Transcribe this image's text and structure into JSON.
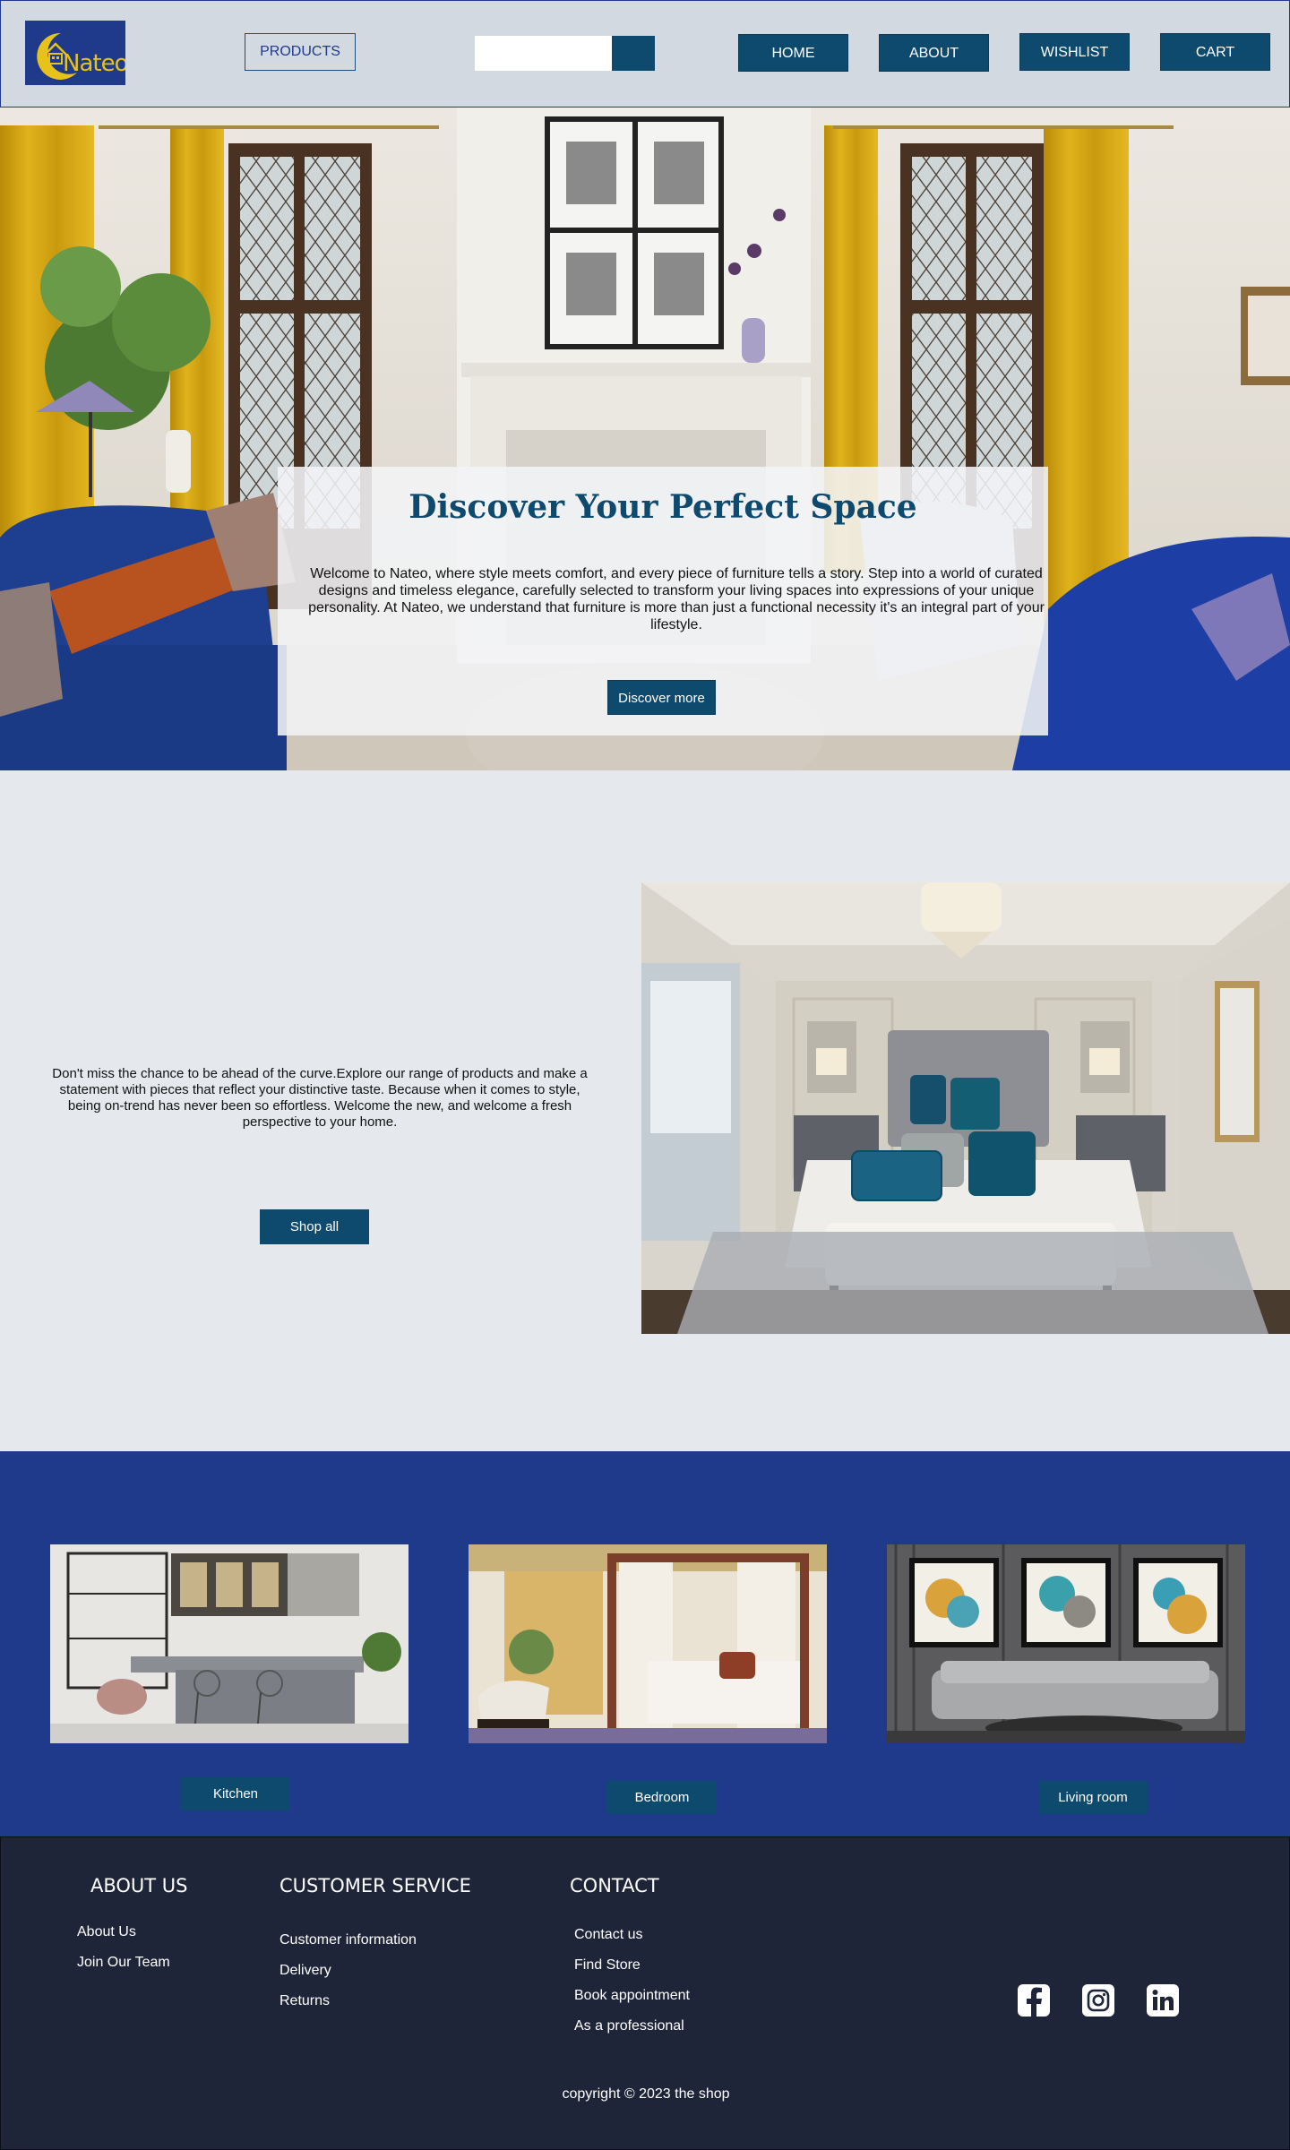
{
  "header": {
    "logo_text": "Nateo",
    "products_label": "PRODUCTS",
    "search_placeholder": "",
    "nav": [
      "HOME",
      "ABOUT",
      "WISHLIST",
      "CART"
    ]
  },
  "hero": {
    "title": "Discover Your Perfect Space",
    "text": "Welcome to Nateo, where style meets comfort, and every piece of furniture tells a story. Step into a world of curated designs and timeless elegance, carefully selected to transform your living spaces into expressions of your unique personality. At Nateo, we understand that furniture is more than just a functional necessity it's an integral part of your lifestyle.",
    "button_label": "Discover more"
  },
  "promo": {
    "text": "Don't miss the chance to be ahead of the curve.Explore our range of products and make a statement with pieces that reflect your distinctive taste. Because when it comes to style, being on-trend has never been so effortless. Welcome the new, and welcome a fresh perspective to your home.",
    "button_label": "Shop all"
  },
  "categories": [
    {
      "label": "Kitchen"
    },
    {
      "label": "Bedroom"
    },
    {
      "label": "Living room"
    }
  ],
  "footer": {
    "about_heading": "ABOUT US",
    "about_links": [
      "About Us",
      "Join Our Team"
    ],
    "service_heading": "CUSTOMER SERVICE",
    "service_links": [
      "Customer information",
      "Delivery",
      "Returns"
    ],
    "contact_heading": "CONTACT",
    "contact_links": [
      "Contact us",
      "Find Store",
      "Book appointment",
      "As a professional"
    ],
    "social_icons": [
      "facebook-icon",
      "instagram-icon",
      "linkedin-icon"
    ],
    "copyright": "copyright © 2023 the shop"
  },
  "colors": {
    "brand_dark_blue": "#0e4a6e",
    "royal_blue": "#1f3a8a",
    "header_bg": "#d2d9e0",
    "footer_bg": "#1e2538",
    "logo_gold": "#e6c21a"
  }
}
